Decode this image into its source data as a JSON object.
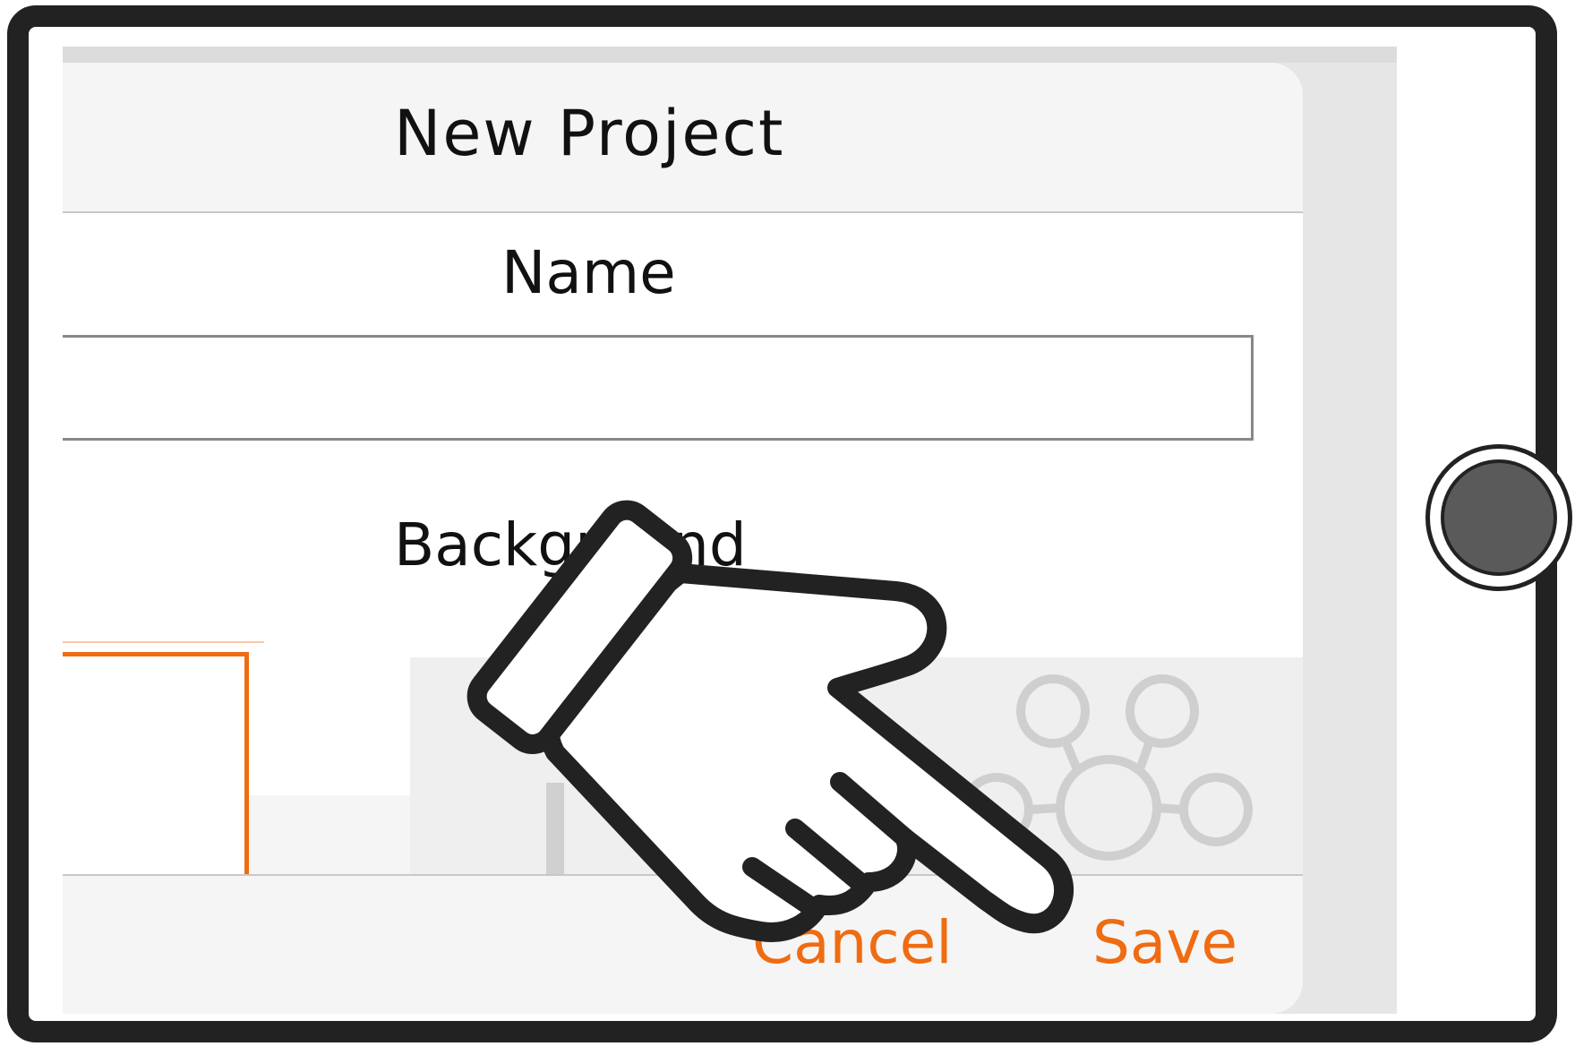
{
  "dialog": {
    "title": "New Project",
    "name_label": "Name",
    "name_value": "",
    "background_label": "Background",
    "background_options": [
      "blank-canvas",
      "mind-map-template"
    ],
    "cancel_label": "Cancel",
    "save_label": "Save"
  },
  "colors": {
    "accent": "#ef6c12",
    "device_frame": "#222222",
    "dialog_bg": "#f5f5f5"
  },
  "icons": [
    "pointing-hand-icon",
    "mind-map-icon",
    "home-button"
  ]
}
